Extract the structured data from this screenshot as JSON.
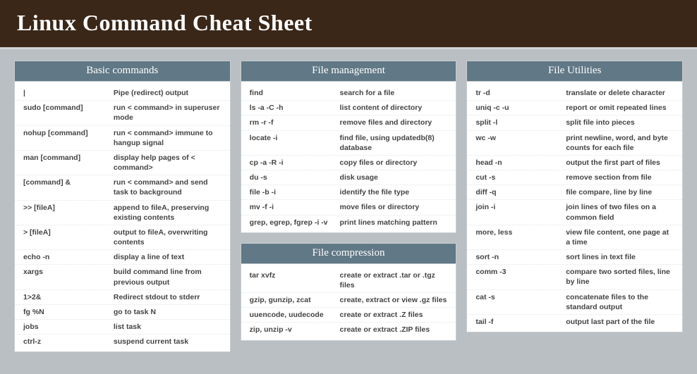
{
  "header": {
    "title": "Linux Command Cheat Sheet"
  },
  "columns": [
    {
      "sections": [
        {
          "title": "Basic commands",
          "rows": [
            {
              "cmd": "|",
              "desc": "Pipe (redirect) output"
            },
            {
              "cmd": "sudo [command]",
              "desc": "run < command> in superuser mode"
            },
            {
              "cmd": "nohup [command]",
              "desc": "run < command> immune to hangup signal"
            },
            {
              "cmd": "man [command]",
              "desc": "display help pages of < command>"
            },
            {
              "cmd": "[command] &",
              "desc": "run < command> and send task to background"
            },
            {
              "cmd": ">> [fileA]",
              "desc": "append to fileA, preserving existing contents"
            },
            {
              "cmd": "> [fileA]",
              "desc": "output to fileA, overwriting contents"
            },
            {
              "cmd": "echo -n",
              "desc": "display a line of text"
            },
            {
              "cmd": "xargs",
              "desc": "build command line from previous output"
            },
            {
              "cmd": "1>2&",
              "desc": "Redirect stdout to stderr"
            },
            {
              "cmd": "fg %N",
              "desc": "go to task N"
            },
            {
              "cmd": "jobs",
              "desc": "list task"
            },
            {
              "cmd": "ctrl-z",
              "desc": "suspend current task"
            }
          ]
        }
      ]
    },
    {
      "sections": [
        {
          "title": "File management",
          "rows": [
            {
              "cmd": "find",
              "desc": "search for a file"
            },
            {
              "cmd": "ls -a -C -h",
              "desc": "list content of directory"
            },
            {
              "cmd": "rm -r -f",
              "desc": "remove files and directory"
            },
            {
              "cmd": "locate -i",
              "desc": "find file, using updatedb(8) database"
            },
            {
              "cmd": "cp -a -R -i",
              "desc": "copy files or directory"
            },
            {
              "cmd": "du -s",
              "desc": "disk usage"
            },
            {
              "cmd": "file -b -i",
              "desc": "identify the file type"
            },
            {
              "cmd": "mv -f -i",
              "desc": "move files or directory"
            },
            {
              "cmd": "grep, egrep, fgrep -i -v",
              "desc": "print lines matching pattern"
            }
          ]
        },
        {
          "title": "File compression",
          "rows": [
            {
              "cmd": "tar xvfz",
              "desc": "create or extract .tar or .tgz files"
            },
            {
              "cmd": "gzip, gunzip, zcat",
              "desc": "create, extract or view .gz files"
            },
            {
              "cmd": "uuencode, uudecode",
              "desc": "create or extract .Z files"
            },
            {
              "cmd": "zip, unzip -v",
              "desc": "create or extract .ZIP files"
            }
          ]
        }
      ]
    },
    {
      "sections": [
        {
          "title": "File Utilities",
          "rows": [
            {
              "cmd": "tr -d",
              "desc": "translate or delete character"
            },
            {
              "cmd": "uniq -c -u",
              "desc": "report or omit repeated lines"
            },
            {
              "cmd": "split -l",
              "desc": "split file into pieces"
            },
            {
              "cmd": "wc -w",
              "desc": "print newline, word, and byte counts for each file"
            },
            {
              "cmd": "head -n",
              "desc": "output the first part of files"
            },
            {
              "cmd": "cut -s",
              "desc": "remove section from file"
            },
            {
              "cmd": "diff -q",
              "desc": "file compare, line by line"
            },
            {
              "cmd": "join -i",
              "desc": "join lines of two files on a common field"
            },
            {
              "cmd": "more, less",
              "desc": "view file content, one page at a time"
            },
            {
              "cmd": "sort -n",
              "desc": "sort lines in text file"
            },
            {
              "cmd": "comm -3",
              "desc": "compare two sorted files, line by line"
            },
            {
              "cmd": "cat -s",
              "desc": "concatenate files to the standard output"
            },
            {
              "cmd": "tail -f",
              "desc": "output last part of the file"
            }
          ]
        }
      ]
    }
  ]
}
